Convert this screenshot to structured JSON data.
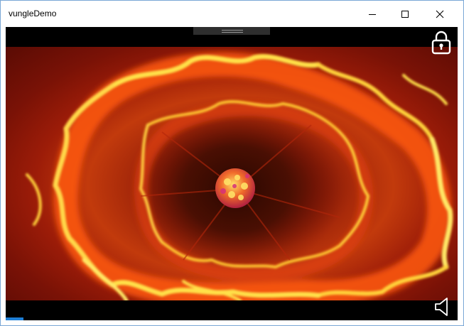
{
  "window": {
    "title": "vungleDemo",
    "controls": [
      "minimize",
      "maximize",
      "close"
    ]
  },
  "player": {
    "icons": {
      "drag_handle": "drag-handle-icon",
      "lock": "lock-icon",
      "sound": "speaker-icon"
    },
    "progress_fraction": 0.04,
    "colors": {
      "progress": "#1e7fd6",
      "background": "#000000"
    }
  }
}
